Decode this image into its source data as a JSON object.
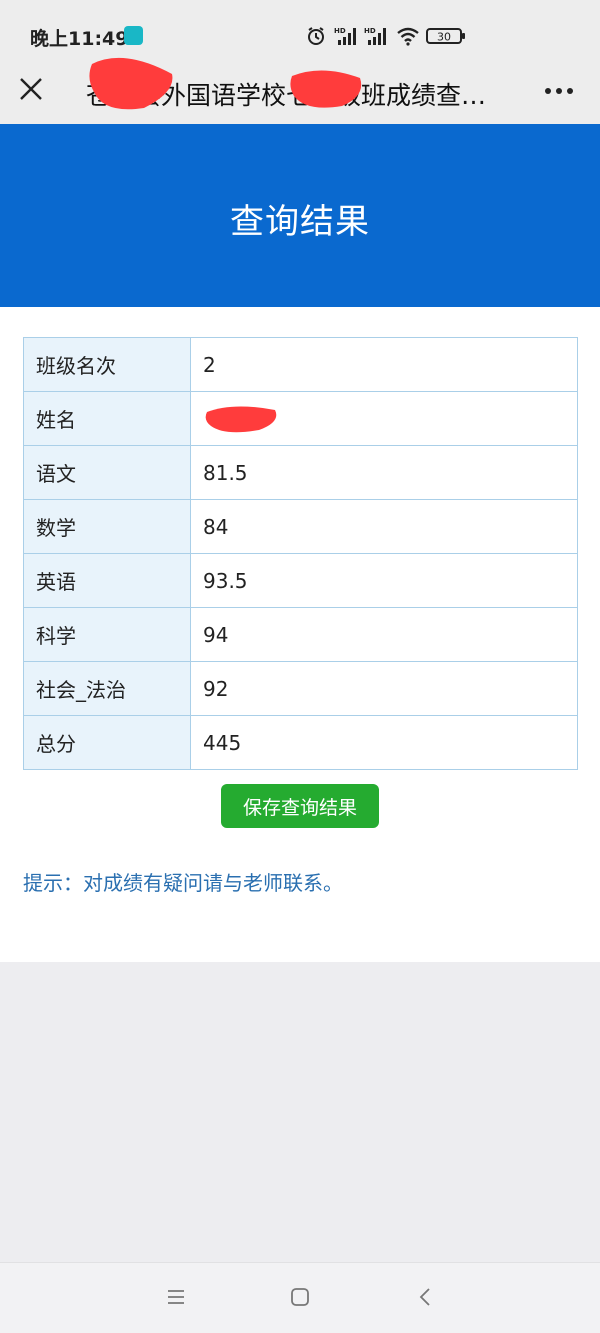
{
  "status_bar": {
    "time": "晚上11:49",
    "battery": "30",
    "signal_label_1": "HD",
    "signal_label_2": "HD"
  },
  "nav": {
    "title": "苍南县外国语学校七年级班成绩查…"
  },
  "banner": {
    "title": "查询结果"
  },
  "results": {
    "rows": [
      {
        "label": "班级名次",
        "value": "2"
      },
      {
        "label": "姓名",
        "value": ""
      },
      {
        "label": "语文",
        "value": "81.5"
      },
      {
        "label": "数学",
        "value": "84"
      },
      {
        "label": "英语",
        "value": "93.5"
      },
      {
        "label": "科学",
        "value": "94"
      },
      {
        "label": "社会_法治",
        "value": "92"
      },
      {
        "label": "总分",
        "value": "445"
      }
    ]
  },
  "actions": {
    "save_label": "保存查询结果"
  },
  "hint": {
    "text": "提示：对成绩有疑问请与老师联系。"
  },
  "colors": {
    "banner": "#0a69cf",
    "save_button": "#25ab30",
    "hint": "#2a6fb0",
    "label_cell": "#e8f3fb",
    "redaction": "#ff3c3c"
  }
}
